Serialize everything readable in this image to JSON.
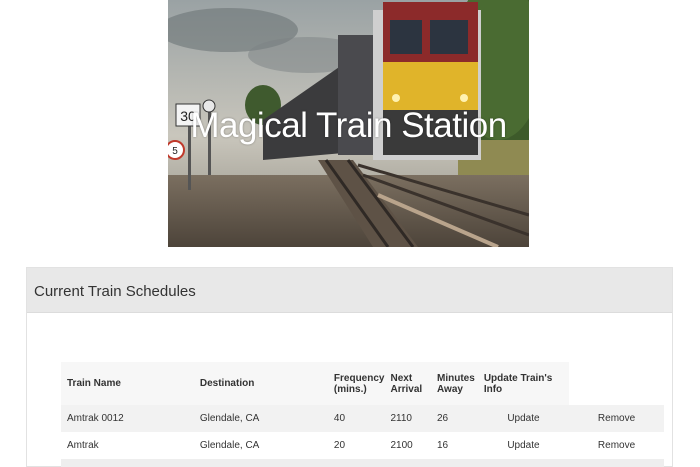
{
  "hero": {
    "title": "Magical Train Station",
    "image_alt": "Freight train locomotive on railway tracks",
    "signs": {
      "speed": "30",
      "circle": "5"
    }
  },
  "panel": {
    "heading": "Current Train Schedules"
  },
  "schedule": {
    "headers": {
      "name": "Train Name",
      "destination": "Destination",
      "frequency_line1": "Frequency",
      "frequency_line2": "(mins.)",
      "next_line1": "Next",
      "next_line2": "Arrival",
      "minutes_line1": "Minutes",
      "minutes_line2": "Away",
      "update": "Update Train's Info"
    },
    "rows": [
      {
        "name": "Amtrak 0012",
        "destination": "Glendale, CA",
        "frequency": "40",
        "next_arrival": "2110",
        "minutes_away": "26",
        "update_label": "Update",
        "remove_label": "Remove"
      },
      {
        "name": "Amtrak",
        "destination": "Glendale, CA",
        "frequency": "20",
        "next_arrival": "2100",
        "minutes_away": "16",
        "update_label": "Update",
        "remove_label": "Remove"
      }
    ]
  },
  "colors": {
    "locomotive_red": "#8c2a2a",
    "locomotive_yellow": "#e0b42a",
    "heading_bg": "#e8e8e8"
  }
}
